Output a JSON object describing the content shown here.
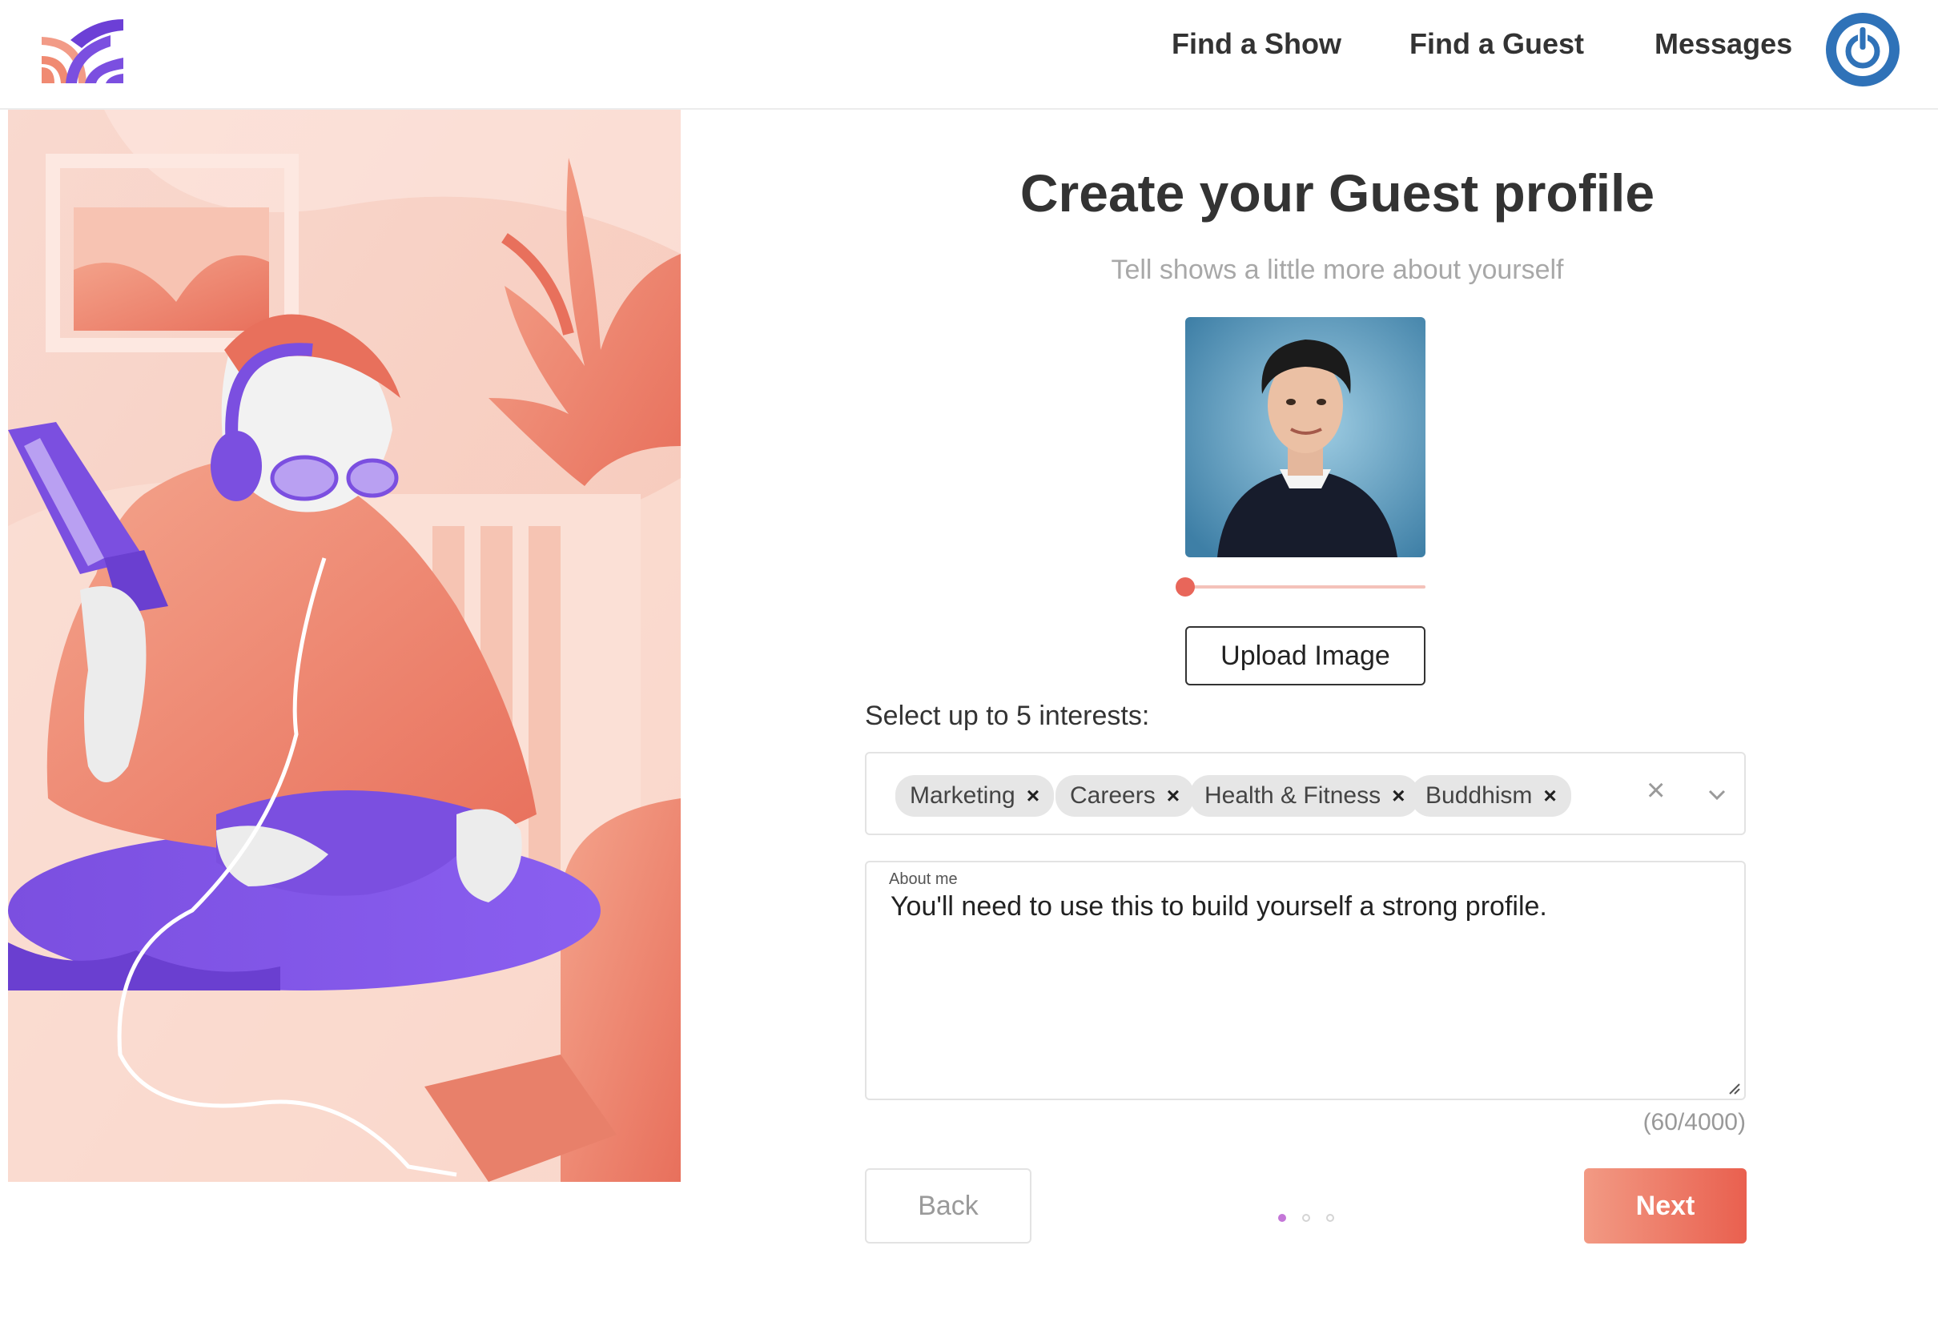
{
  "header": {
    "nav": {
      "find_show": "Find a Show",
      "find_guest": "Find a Guest",
      "messages": "Messages"
    },
    "avatar_icon": "power-icon"
  },
  "form": {
    "title": "Create your Guest profile",
    "subtitle": "Tell shows a little more about yourself",
    "photo_zoom": 0.0,
    "upload_label": "Upload Image",
    "interests_label": "Select up to 5 interests:",
    "interests": [
      "Marketing",
      "Careers",
      "Health & Fitness",
      "Buddhism"
    ],
    "about_label": "About me",
    "about_text": "You'll need to use this to build yourself a strong profile.",
    "counter": "(60/4000)",
    "back_label": "Back",
    "next_label": "Next",
    "steps_total": 3,
    "step_active": 1
  },
  "colors": {
    "accent": "#e8665a",
    "accent_light": "#f29a84",
    "purple": "#7b4fe0",
    "avatar_blue": "#2f72b8"
  }
}
